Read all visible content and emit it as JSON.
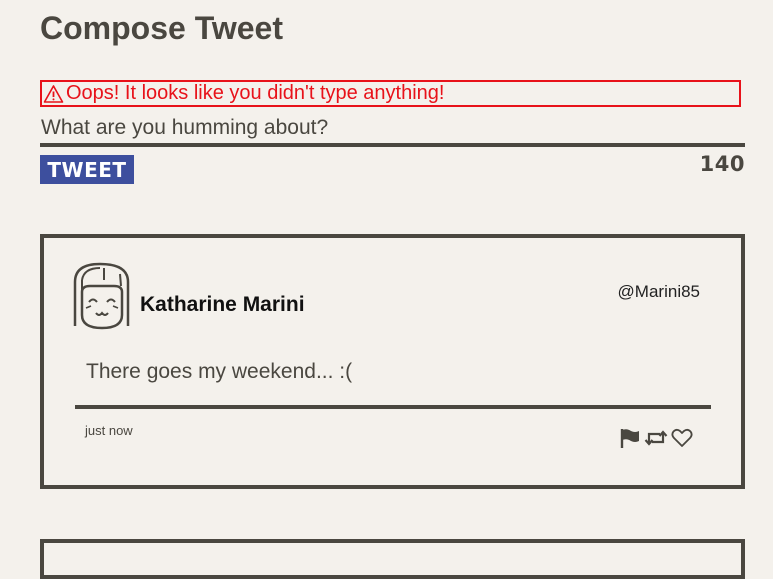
{
  "page": {
    "title": "Compose Tweet"
  },
  "compose": {
    "error_message": "Oops! It looks like you didn't type anything!",
    "placeholder": "What are you humming about?",
    "value": "",
    "button_label": "TWEET",
    "char_counter": "140"
  },
  "tweets": [
    {
      "author_name": "Katharine Marini",
      "handle": "@Marini85",
      "text": "There goes my weekend... :(",
      "timestamp": "just now",
      "actions": [
        "flag-icon",
        "retweet-icon",
        "heart-icon"
      ]
    }
  ],
  "colors": {
    "background": "#f4f1ec",
    "text": "#4a4740",
    "error": "#e8121a",
    "button": "#3d4f9e"
  }
}
